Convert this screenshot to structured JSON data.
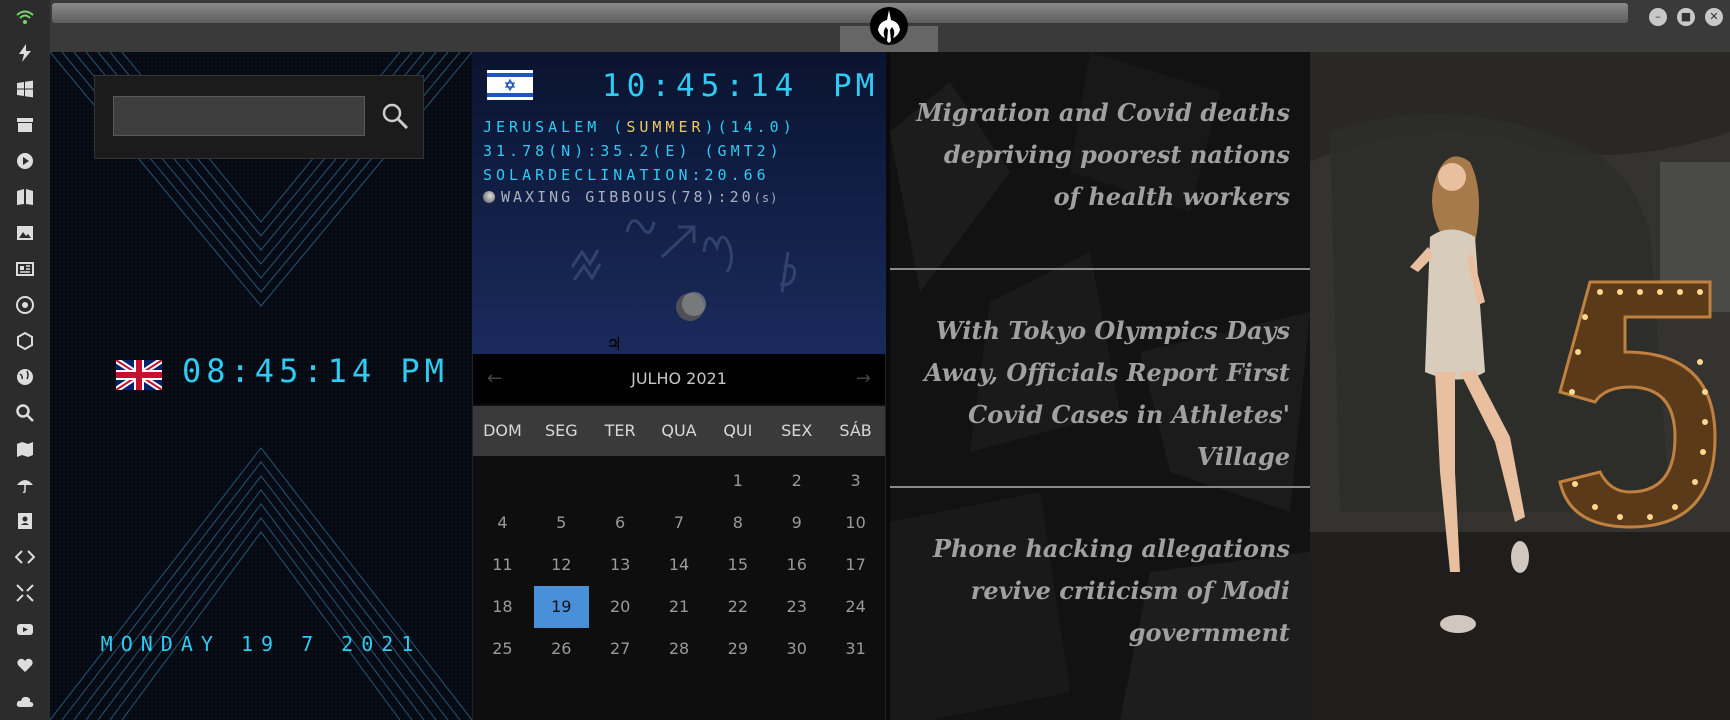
{
  "sidebar": {
    "icons": [
      "wifi-icon",
      "bolt-icon",
      "windows-icon",
      "archive-icon",
      "play-icon",
      "book-icon",
      "image-icon",
      "news-icon",
      "aperture-icon",
      "hexagon-icon",
      "globe-icon",
      "search-icon",
      "map-icon",
      "umbrella-icon",
      "contacts-icon",
      "code-icon",
      "fullscreen-icon",
      "youtube-icon",
      "heart-icon",
      "cloud-icon"
    ],
    "accent": "#7ad46a"
  },
  "titlebar": {
    "emblem": "rebel-alliance-icon",
    "controls": [
      "minimize-icon",
      "maximize-icon",
      "close-icon"
    ]
  },
  "search": {
    "value": "",
    "button_icon": "search-icon"
  },
  "clock_local": {
    "flag": "uk-flag",
    "time": "08:45:14 PM",
    "date": "MONDAY 19 7 2021",
    "color": "#2ecbf2"
  },
  "clock_world": {
    "flag": "israel-flag",
    "time": "10:45:14",
    "ampm": "PM",
    "city": "JERUSALEM",
    "season": "SUMMER",
    "offset": "(14.0)",
    "coords": "31.78(N):35.2(E) (GMT2)",
    "solar": "SOLARDECLINATION:20.66",
    "moon": "WAXING GIBBOUS(78):20",
    "moon_suffix": "(s)"
  },
  "calendar": {
    "month": "JULHO 2021",
    "prev": "←",
    "next": "→",
    "weekdays": [
      "DOM",
      "SEG",
      "TER",
      "QUA",
      "QUI",
      "SEX",
      "SÁB"
    ],
    "days": [
      "",
      "",
      "",
      "",
      "1",
      "2",
      "3",
      "4",
      "5",
      "6",
      "7",
      "8",
      "9",
      "10",
      "11",
      "12",
      "13",
      "14",
      "15",
      "16",
      "17",
      "18",
      "19",
      "20",
      "21",
      "22",
      "23",
      "24",
      "25",
      "26",
      "27",
      "28",
      "29",
      "30",
      "31"
    ],
    "today": "19",
    "highlight_color": "#4a90d9"
  },
  "news": {
    "items": [
      "Migration and Covid deaths depriving poorest nations of health workers",
      "With Tokyo Olympics Days Away, Officials Report First Covid Cases in Athletes' Village",
      "Phone hacking allegations revive criticism of Modi government"
    ]
  },
  "photo": {
    "sign": "5"
  }
}
